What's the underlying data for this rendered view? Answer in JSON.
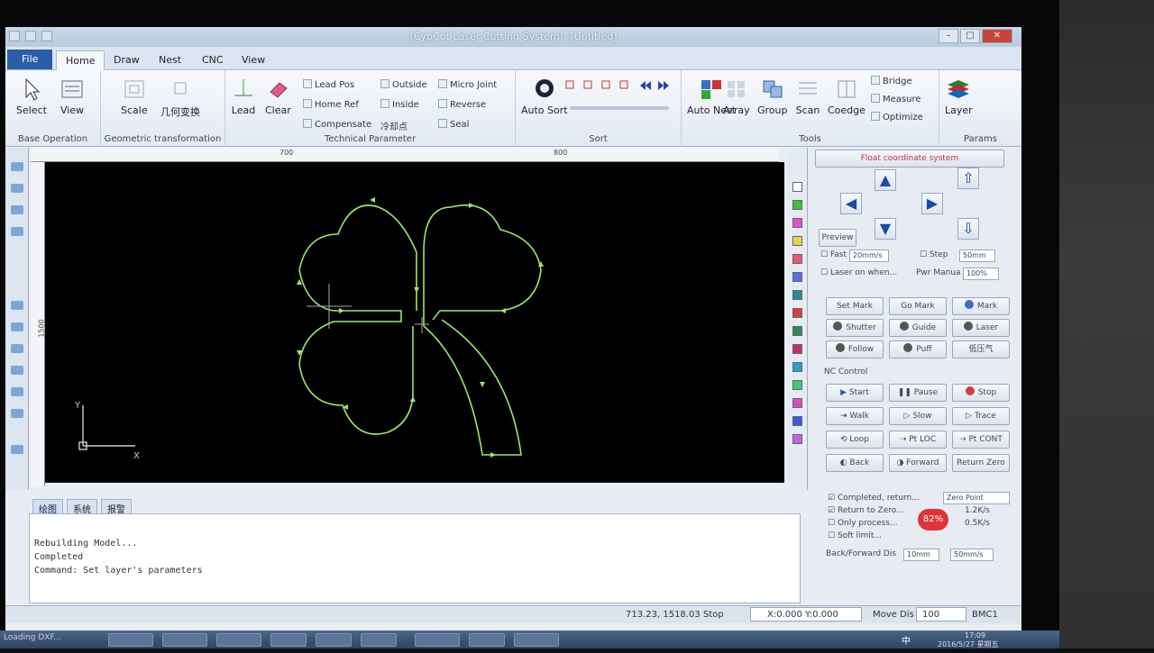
{
  "window": {
    "title": "(CypCut Laser Cutting System)  -[Untitled]"
  },
  "tabs": [
    "File",
    "Home",
    "Draw",
    "Nest",
    "CNC",
    "View"
  ],
  "ribbon": {
    "select": "Select",
    "view": "View",
    "base_op": "Base Operation",
    "scale": "Scale",
    "geo_cn": "几何变换",
    "geo": "Geometric transformation",
    "lead": "Lead",
    "clear": "Clear",
    "lead_pos": "Lead Pos",
    "home_ref": "Home Ref",
    "compensate": "Compensate",
    "comp_cn": "冷却点",
    "outside": "Outside",
    "inside": "Inside",
    "micro_joint": "Micro Joint",
    "reverse": "Reverse",
    "seal": "Seal",
    "tech": "Technical Parameter",
    "auto_sort": "Auto Sort",
    "sort": "Sort",
    "auto_nest": "Auto Nest",
    "array": "Array",
    "group": "Group",
    "scan": "Scan",
    "coedge": "Coedge",
    "bridge": "Bridge",
    "measure": "Measure",
    "optimize": "Optimize",
    "tools": "Tools",
    "layer": "Layer",
    "params": "Params"
  },
  "ruler": {
    "h1": "700",
    "h2": "800",
    "v1": "1500"
  },
  "axis": {
    "x": "X",
    "y": "Y"
  },
  "panel": {
    "coord": "Float coordinate system",
    "preview": "Preview",
    "fast": "Fast",
    "fast_val": "20mm/s",
    "step": "Step",
    "step_val": "50mm",
    "laser_on": "Laser on when...",
    "pwr": "Pwr Manua",
    "pwr_val": "100%",
    "set_mark": "Set Mark",
    "go_mark": "Go Mark",
    "mark": "Mark",
    "shutter": "Shutter",
    "guide": "Guide",
    "laser": "Laser",
    "follow": "Follow",
    "puff": "Puff",
    "low_gas": "低压气",
    "nc": "NC Control",
    "start": "Start",
    "pause": "Pause",
    "stop": "Stop",
    "walk": "Walk",
    "slow": "Slow",
    "trace": "Trace",
    "loop": "Loop",
    "pt_loc": "Pt LOC",
    "pt_cont": "Pt CONT",
    "back": "Back",
    "forward": "Forward",
    "return_zero": "Return Zero",
    "completed": "Completed, return...",
    "zero_point": "Zero Point",
    "return_to_zero": "Return to Zero...",
    "only_process": "Only process...",
    "soft_limit": "Soft limit...",
    "bf_dis": "Back/Forward Dis",
    "bf_val": "10mm",
    "speed_val": "50mm/s",
    "small1": "1.2K/s",
    "small2": "0.5K/s"
  },
  "console": {
    "tabs": [
      "绘图",
      "系统",
      "报警"
    ],
    "lines": [
      "Rebuilding Model...",
      "Completed",
      "Command: Set layer's parameters"
    ]
  },
  "status": {
    "coords": "713.23, 1518.03",
    "state": "Stop",
    "xy": "X:0.000 Y:0.000",
    "move_label": "Move Dis",
    "move_val": "100",
    "bmc": "BMC1",
    "loading": "Loading DXF..."
  },
  "tray": {
    "badge": "82%",
    "ime": "中",
    "time": "17:09",
    "date": "2016/5/27 星期五"
  }
}
